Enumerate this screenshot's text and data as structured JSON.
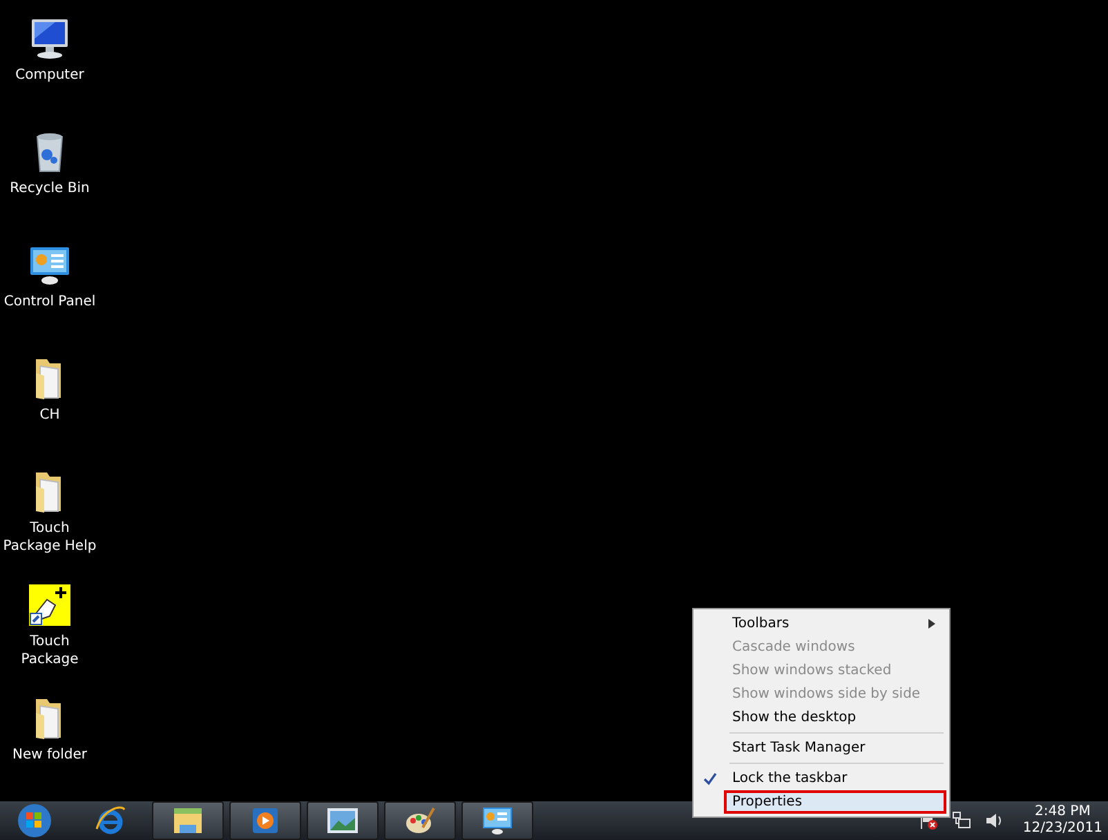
{
  "desktop_icons": [
    {
      "label": "Computer",
      "kind": "computer"
    },
    {
      "label": "Recycle Bin",
      "kind": "recycle-bin"
    },
    {
      "label": "Control Panel",
      "kind": "control-panel"
    },
    {
      "label": "CH",
      "kind": "folder"
    },
    {
      "label": "Touch Package Help",
      "kind": "folder"
    },
    {
      "label": "Touch Package",
      "kind": "shortcut"
    },
    {
      "label": "New folder",
      "kind": "folder"
    }
  ],
  "context_menu": {
    "groups": [
      {
        "items": [
          {
            "label": "Toolbars",
            "disabled": false,
            "checked": false,
            "submenu": true,
            "selected": false
          },
          {
            "label": "Cascade windows",
            "disabled": true,
            "checked": false,
            "submenu": false,
            "selected": false
          },
          {
            "label": "Show windows stacked",
            "disabled": true,
            "checked": false,
            "submenu": false,
            "selected": false
          },
          {
            "label": "Show windows side by side",
            "disabled": true,
            "checked": false,
            "submenu": false,
            "selected": false
          },
          {
            "label": "Show the desktop",
            "disabled": false,
            "checked": false,
            "submenu": false,
            "selected": false
          }
        ]
      },
      {
        "items": [
          {
            "label": "Start Task Manager",
            "disabled": false,
            "checked": false,
            "submenu": false,
            "selected": false
          }
        ]
      },
      {
        "items": [
          {
            "label": "Lock the taskbar",
            "disabled": false,
            "checked": true,
            "submenu": false,
            "selected": false
          },
          {
            "label": "Properties",
            "disabled": false,
            "checked": false,
            "submenu": false,
            "selected": true
          }
        ]
      }
    ]
  },
  "taskbar": {
    "items": [
      {
        "kind": "browser",
        "running": false
      },
      {
        "kind": "explorer",
        "running": true
      },
      {
        "kind": "media",
        "running": true
      },
      {
        "kind": "photos",
        "running": true
      },
      {
        "kind": "paint",
        "running": true
      },
      {
        "kind": "control-panel",
        "running": true
      }
    ],
    "clock": {
      "time": "2:48 PM",
      "date": "12/23/2011"
    }
  }
}
